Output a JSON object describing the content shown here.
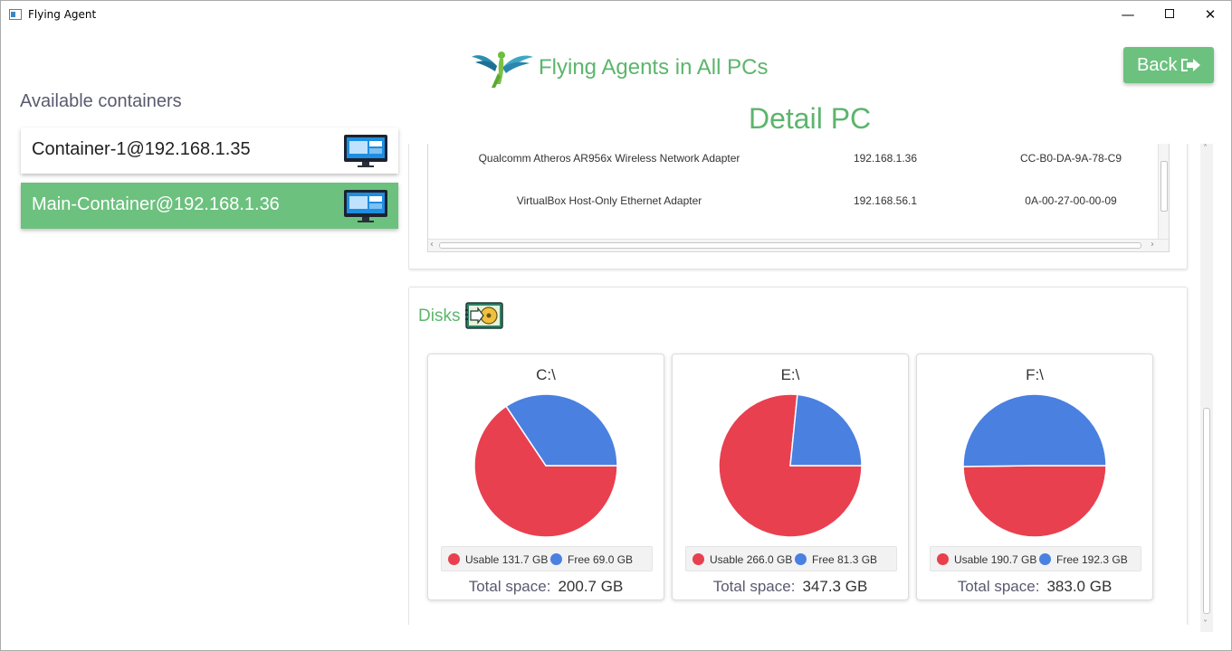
{
  "window": {
    "title": "Flying Agent",
    "minimize_glyph": "—",
    "close_glyph": "✕"
  },
  "header": {
    "title": "Flying Agents in All PCs",
    "back_label": "Back"
  },
  "sidebar": {
    "heading": "Available containers",
    "items": [
      {
        "label": "Container-1@192.168.1.35",
        "selected": false
      },
      {
        "label": "Main-Container@192.168.1.36",
        "selected": true
      }
    ]
  },
  "detail": {
    "title": "Detail PC"
  },
  "network": {
    "rows": [
      {
        "name": "Qualcomm Atheros AR956x Wireless Network Adapter",
        "ip": "192.168.1.36",
        "mac": "CC-B0-DA-9A-78-C9"
      },
      {
        "name": "VirtualBox Host-Only Ethernet Adapter",
        "ip": "192.168.56.1",
        "mac": "0A-00-27-00-00-09"
      }
    ]
  },
  "disks": {
    "title": "Disks",
    "total_label": "Total space:",
    "colors": {
      "usable": "#e8404f",
      "free": "#4a80e0"
    },
    "items": [
      {
        "name": "C:\\",
        "usable_label": "Usable 131.7 GB",
        "free_label": "Free 69.0 GB",
        "usable": 131.7,
        "free": 69.0,
        "total": "200.7 GB"
      },
      {
        "name": "E:\\",
        "usable_label": "Usable 266.0 GB",
        "free_label": "Free 81.3 GB",
        "usable": 266.0,
        "free": 81.3,
        "total": "347.3 GB"
      },
      {
        "name": "F:\\",
        "usable_label": "Usable 190.7 GB",
        "free_label": "Free 192.3 GB",
        "usable": 190.7,
        "free": 192.3,
        "total": "383.0 GB"
      }
    ]
  }
}
